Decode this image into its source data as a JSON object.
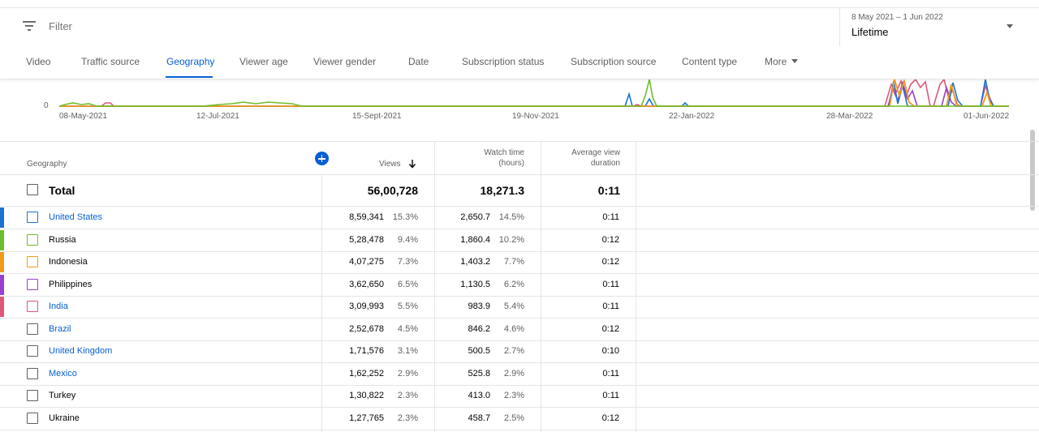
{
  "filter": {
    "placeholder": "Filter",
    "icon": "filter-list-icon"
  },
  "date_range": {
    "range": "8 May 2021 – 1 Jun 2022",
    "label": "Lifetime"
  },
  "tabs": [
    {
      "label": "Video"
    },
    {
      "label": "Traffic source"
    },
    {
      "label": "Geography",
      "active": true
    },
    {
      "label": "Viewer age"
    },
    {
      "label": "Viewer gender"
    },
    {
      "label": "Date"
    },
    {
      "label": "Subscription status"
    },
    {
      "label": "Subscription source"
    },
    {
      "label": "Content type"
    },
    {
      "label": "More"
    }
  ],
  "chart": {
    "y_tick": "0",
    "x_ticks": [
      "08-May-2021",
      "12-Jul-2021",
      "15-Sept-2021",
      "19-Nov-2021",
      "22-Jan-2022",
      "28-Mar-2022",
      "01-Jun-2022"
    ],
    "colors": {
      "united_states": "#1a73d1",
      "russia": "#6cbf2c",
      "indonesia": "#f29b19",
      "philippines": "#9a3fd0",
      "india": "#e0577a"
    }
  },
  "table": {
    "headers": {
      "geography": "Geography",
      "views": "Views",
      "watch_time_1": "Watch time",
      "watch_time_2": "(hours)",
      "avg_1": "Average view",
      "avg_2": "duration"
    },
    "sort_icon": "arrow-down-icon",
    "add_column_icon": "add-circle-icon",
    "total": {
      "label": "Total",
      "views": "56,00,728",
      "watch_time": "18,271.3",
      "avg_duration": "0:11"
    },
    "rows": [
      {
        "country": "United States",
        "views": "8,59,341",
        "views_pct": "15.3%",
        "watch_time": "2,650.7",
        "watch_pct": "14.5%",
        "avg": "0:11",
        "color": "#1a73d1",
        "link": true
      },
      {
        "country": "Russia",
        "views": "5,28,478",
        "views_pct": "9.4%",
        "watch_time": "1,860.4",
        "watch_pct": "10.2%",
        "avg": "0:12",
        "color": "#6cbf2c",
        "link": false
      },
      {
        "country": "Indonesia",
        "views": "4,07,275",
        "views_pct": "7.3%",
        "watch_time": "1,403.2",
        "watch_pct": "7.7%",
        "avg": "0:12",
        "color": "#f29b19",
        "link": false
      },
      {
        "country": "Philippines",
        "views": "3,62,650",
        "views_pct": "6.5%",
        "watch_time": "1,130.5",
        "watch_pct": "6.2%",
        "avg": "0:11",
        "color": "#9a3fd0",
        "link": false
      },
      {
        "country": "India",
        "views": "3,09,993",
        "views_pct": "5.5%",
        "watch_time": "983.9",
        "watch_pct": "5.4%",
        "avg": "0:11",
        "color": "#e0577a",
        "link": true
      },
      {
        "country": "Brazil",
        "views": "2,52,678",
        "views_pct": "4.5%",
        "watch_time": "846.2",
        "watch_pct": "4.6%",
        "avg": "0:12",
        "color": "",
        "link": true
      },
      {
        "country": "United Kingdom",
        "views": "1,71,576",
        "views_pct": "3.1%",
        "watch_time": "500.5",
        "watch_pct": "2.7%",
        "avg": "0:10",
        "color": "",
        "link": true
      },
      {
        "country": "Mexico",
        "views": "1,62,252",
        "views_pct": "2.9%",
        "watch_time": "525.8",
        "watch_pct": "2.9%",
        "avg": "0:11",
        "color": "",
        "link": true
      },
      {
        "country": "Turkey",
        "views": "1,30,822",
        "views_pct": "2.3%",
        "watch_time": "413.0",
        "watch_pct": "2.3%",
        "avg": "0:11",
        "color": "",
        "link": false
      },
      {
        "country": "Ukraine",
        "views": "1,27,765",
        "views_pct": "2.3%",
        "watch_time": "458.7",
        "watch_pct": "2.5%",
        "avg": "0:12",
        "color": "",
        "link": false
      }
    ]
  }
}
